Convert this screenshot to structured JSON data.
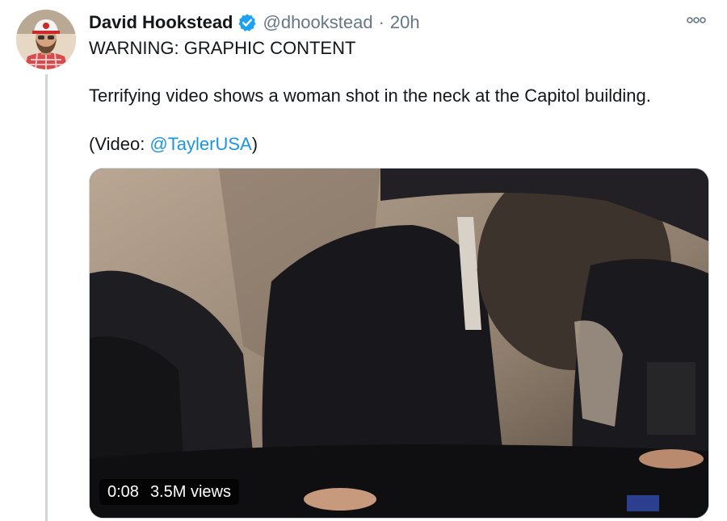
{
  "tweet": {
    "author": {
      "display_name": "David Hookstead",
      "handle": "@dhookstead",
      "verified": true,
      "avatar_icon": "avatar-photo"
    },
    "separator": "·",
    "timestamp": "20h",
    "warning": "WARNING: GRAPHIC CONTENT",
    "body": "Terrifying video shows a woman shot in the neck at the Capitol building.",
    "credit_prefix": "(Video: ",
    "credit_mention": "@TaylerUSA",
    "credit_suffix": ")",
    "more_icon": "more-options-icon"
  },
  "video": {
    "duration": "0:08",
    "views": "3.5M views"
  },
  "colors": {
    "text": "#14171a",
    "secondary": "#657786",
    "link": "#1b95e0",
    "verified": "#1da1f2",
    "thread_line": "#ccd6dd"
  }
}
